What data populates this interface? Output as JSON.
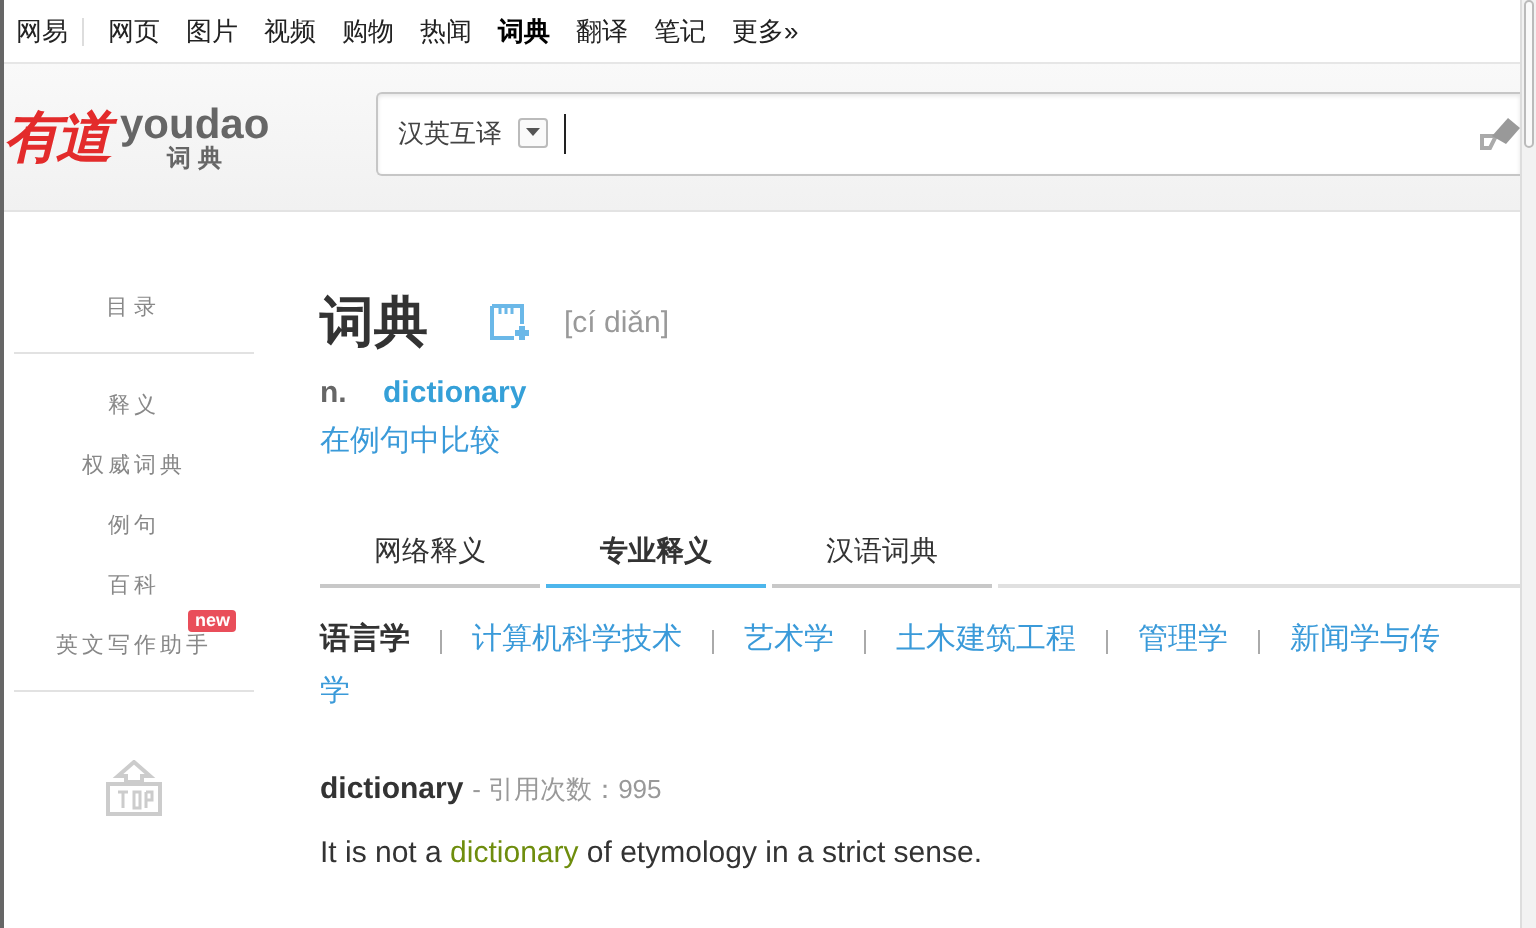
{
  "top_nav": {
    "home": "网易",
    "items": [
      {
        "label": "网页",
        "selected": false
      },
      {
        "label": "图片",
        "selected": false
      },
      {
        "label": "视频",
        "selected": false
      },
      {
        "label": "购物",
        "selected": false
      },
      {
        "label": "热闻",
        "selected": false
      },
      {
        "label": "词典",
        "selected": true
      },
      {
        "label": "翻译",
        "selected": false
      },
      {
        "label": "笔记",
        "selected": false
      },
      {
        "label": "更多»",
        "selected": false
      }
    ]
  },
  "logo": {
    "brand_cn": "有道",
    "brand_en": "youdao",
    "product": "词 典"
  },
  "search": {
    "mode": "汉英互译"
  },
  "sidebar": {
    "heading": "目录",
    "items": [
      {
        "label": "释义"
      },
      {
        "label": "权威词典"
      },
      {
        "label": "例句"
      },
      {
        "label": "百科"
      },
      {
        "label": "英文写作助手",
        "badge": "new"
      }
    ]
  },
  "entry": {
    "headword": "词典",
    "pinyin": "[cí diǎn]",
    "pos": "n.",
    "translation": "dictionary",
    "compare_link": "在例句中比较"
  },
  "tabs": [
    {
      "label": "网络释义",
      "selected": false
    },
    {
      "label": "专业释义",
      "selected": true
    },
    {
      "label": "汉语词典",
      "selected": false
    }
  ],
  "fields": [
    {
      "label": "语言学",
      "selected": true
    },
    {
      "label": "计算机科学技术",
      "selected": false
    },
    {
      "label": "艺术学",
      "selected": false
    },
    {
      "label": "土木建筑工程",
      "selected": false
    },
    {
      "label": "管理学",
      "selected": false
    },
    {
      "label": "新闻学与传",
      "selected": false
    },
    {
      "label": "学",
      "selected": false,
      "kind": "continued"
    }
  ],
  "result": {
    "term": "dictionary",
    "citations": "- 引用次数：995",
    "example": {
      "before": "It is not a ",
      "highlight": "dictionary",
      "after": " of etymology in a strict sense."
    }
  }
}
